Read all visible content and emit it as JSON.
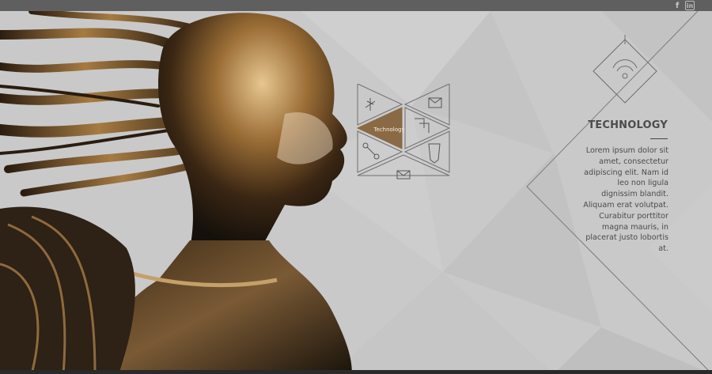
{
  "header": {
    "social": {
      "facebook": "f",
      "linkedin": "in"
    }
  },
  "hex_menu": {
    "active_label": "Technology",
    "items": [
      {
        "icon": "tool-icon"
      },
      {
        "icon": "envelope-icon"
      },
      {
        "icon": "active-technology"
      },
      {
        "icon": "puzzle-icon"
      },
      {
        "icon": "nodes-icon"
      },
      {
        "icon": "shield-icon"
      },
      {
        "icon": "mail-icon"
      }
    ]
  },
  "section": {
    "icon": "signal-icon",
    "title": "TECHNOLOGY",
    "body": "Lorem ipsum dolor sit amet, consectetur adipiscing elit. Nam id leo non ligula dignissim blandit. Aliquam erat volutpat. Curabitur porttitor magna mauris, in placerat justo lobortis at."
  },
  "colors": {
    "background": "#c9c9c9",
    "topbar": "#5f5f5f",
    "accent_bronze": "#8a6a45",
    "text": "#4b4b4b"
  }
}
